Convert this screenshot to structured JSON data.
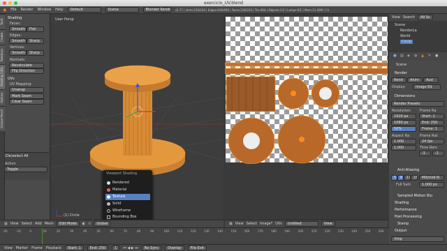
{
  "window": {
    "title": "exercicio_UV.blend"
  },
  "topbar": {
    "file": "File",
    "render": "Render",
    "window": "Window",
    "help": "Help",
    "layout": "Default",
    "scene": "Scene",
    "engine": "Blender Render",
    "stats": "v2.77 | Verts:216/244 | Edges:416/456 | Faces:216/224 | Tris:464 | Objects:1/3 | Lamps:0/1 | Mem:11.40M | Circle"
  },
  "toolshelf": {
    "tabs": [
      "Tools",
      "Create",
      "Relations",
      "Shading / UVs",
      "Options",
      "Grease Pencil"
    ],
    "shading_title": "Shading",
    "faces": "Faces:",
    "smooth": "Smooth",
    "flat": "Flat",
    "edges": "Edges:",
    "sharp": "Sharp",
    "vertices": "Vertices:",
    "normals": "Normals:",
    "recalculate": "Recalculate",
    "flip": "Flip Direction",
    "uvs_title": "UVs",
    "uv_mapping": "UV Mapping:",
    "unwrap": "Unwrap",
    "mark_seam": "Mark Seam",
    "clear_seam": "Clear Seam",
    "deselect": "(De)select All",
    "action": "Action",
    "toggle": "Toggle"
  },
  "viewport": {
    "label": "User Persp",
    "object": "(1) Circle"
  },
  "shading_menu": {
    "title": "Viewport Shading",
    "items": [
      "Rendered",
      "Material",
      "Texture",
      "Solid",
      "Wireframe",
      "Bounding Box"
    ],
    "selected": 2
  },
  "header3d": {
    "view": "View",
    "select": "Select",
    "add": "Add",
    "mesh": "Mesh",
    "mode": "Edit Mode",
    "orientation": "Global"
  },
  "headeruv": {
    "view": "View",
    "select": "Select",
    "image": "Image*",
    "uvs": "UVs",
    "image_name": "Untitled",
    "view2": "View"
  },
  "outliner": {
    "view": "View",
    "search": "Search",
    "all": "All Sc",
    "items": [
      "Scene",
      "RenderLa",
      "World",
      "Circle"
    ]
  },
  "properties": {
    "scene": "Scene",
    "render_title": "Render",
    "render_btn": "Rend",
    "anim_btn": "Anim",
    "audio_btn": "Aud",
    "display": "Display:",
    "display_val": "Image Ed",
    "dimensions": "Dimensions",
    "presets": "Render Presets",
    "resolution": "Resolution:",
    "res_x": "1920 px",
    "res_y": "1080 px",
    "res_pct": "50%",
    "frame_range": "Frame Ra",
    "start": "Start: 1",
    "end": "End: 250",
    "frame": "Frame: 1",
    "aspect": "Aspect Ra:",
    "aspect_x": "1.000",
    "aspect_y": "1.000",
    "frame_rate": "Frame Rat",
    "fps": "24 fps",
    "time_remap": "Time Rem",
    "remap_a": "-1",
    "remap_b": "-1",
    "aa": "Anti-Aliasing",
    "aa_5": "5",
    "aa_8": "8",
    "aa_11": "11",
    "aa_16": "16",
    "aa_filter": "Mitchell-N",
    "full_sample": "Full Sam",
    "aa_size": "1.000 px",
    "sampled_motion": "Sampled Motion Blu",
    "shading": "Shading",
    "performance": "Performance",
    "post": "Post Processing",
    "stamp": "Stamp",
    "output": "Output",
    "output_path": "/tmp"
  },
  "timeline": {
    "view": "View",
    "marker": "Marker",
    "frame": "Frame",
    "playback": "Playback",
    "start": "Start:",
    "start_val": "1",
    "end": "End:",
    "end_val": "250",
    "current": "1",
    "sync": "No Sync",
    "overlay": "Overlay",
    "fileinfo": "File Exit",
    "ticks": [
      "-20",
      "-10",
      "0",
      "10",
      "20",
      "30",
      "40",
      "50",
      "60",
      "70",
      "80",
      "90",
      "100",
      "110",
      "120",
      "130",
      "140",
      "150",
      "160",
      "170",
      "180",
      "190",
      "200",
      "210",
      "220",
      "230",
      "240",
      "250",
      "260"
    ]
  },
  "colors": {
    "accent": "#5680c2",
    "orange": "#e8892f",
    "selected_tab": "#5680c2"
  }
}
